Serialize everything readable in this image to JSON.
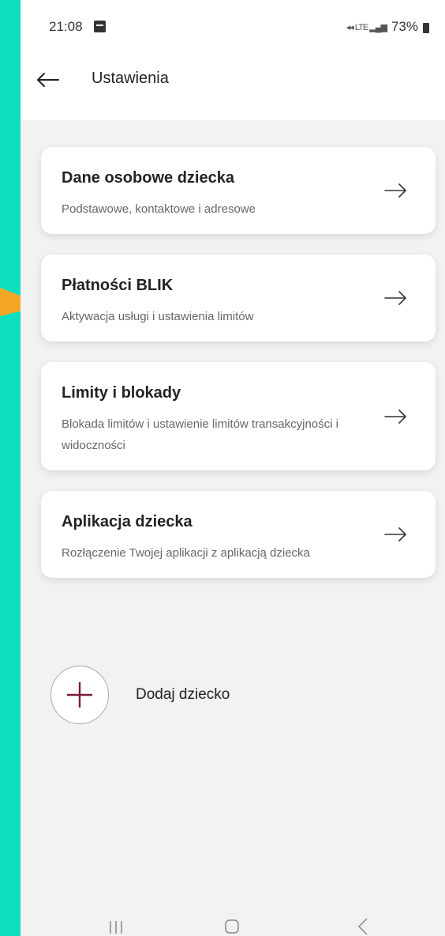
{
  "status": {
    "time": "21:08",
    "network": "LTE",
    "battery": "73%"
  },
  "header": {
    "title": "Ustawienia"
  },
  "cards": [
    {
      "title": "Dane osobowe dziecka",
      "subtitle": "Podstawowe, kontaktowe i adresowe"
    },
    {
      "title": "Płatności BLIK",
      "subtitle": "Aktywacja usługi i ustawienia limitów"
    },
    {
      "title": "Limity i blokady",
      "subtitle": "Blokada limitów i ustawienie limitów transakcyjności i widoczności"
    },
    {
      "title": "Aplikacja dziecka",
      "subtitle": "Rozłączenie Twojej aplikacji z aplikacją dziecka"
    }
  ],
  "add_child": {
    "label": "Dodaj dziecko"
  },
  "colors": {
    "background": "#0de0c0",
    "accent_plus": "#7a1a3f",
    "pointer": "#f5a623"
  },
  "icons": [
    "back-arrow-icon",
    "right-arrow-icon",
    "plus-icon",
    "recent-apps-icon",
    "home-icon",
    "nav-back-icon"
  ]
}
